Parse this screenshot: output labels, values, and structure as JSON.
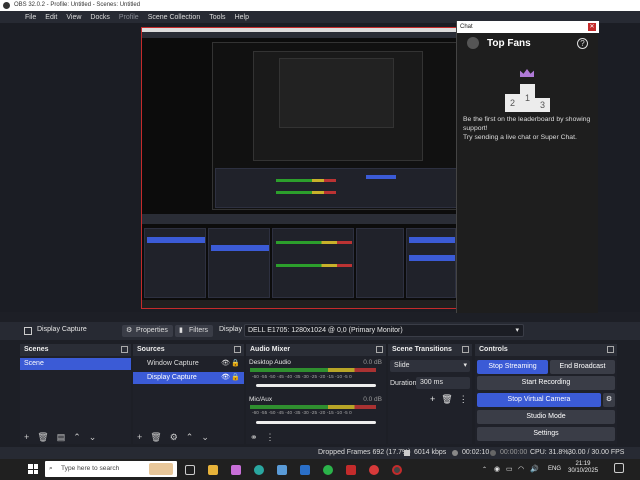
{
  "window": {
    "title": "OBS 32.0.2 - Profile: Untitled - Scenes: Untitled"
  },
  "menu": [
    "File",
    "Edit",
    "View",
    "Docks",
    "Profile",
    "Scene Collection",
    "Tools",
    "Help"
  ],
  "chat": {
    "header": "Chat",
    "title": "Top Fans",
    "message_line1": "Be the first on the leaderboard by showing support!",
    "message_line2": "Try sending a live chat or Super Chat.",
    "podium": [
      "2",
      "1",
      "3"
    ]
  },
  "toolbar": {
    "source_name": "Display Capture",
    "properties": "Properties",
    "filters": "Filters",
    "display_label": "Display",
    "display_value": "DELL E1705: 1280x1024 @ 0,0 (Primary Monitor)"
  },
  "scenes": {
    "title": "Scenes",
    "items": [
      "Scene"
    ]
  },
  "sources": {
    "title": "Sources",
    "items": [
      "Window Capture",
      "Display Capture"
    ]
  },
  "mixer": {
    "title": "Audio Mixer",
    "channels": [
      {
        "name": "Desktop Audio",
        "level": "0.0 dB",
        "scale": "-60 -55 -50 -45 -40 -35 -30 -25 -20 -15 -10 -5 0"
      },
      {
        "name": "Mic/Aux",
        "level": "0.0 dB",
        "scale": "-60 -55 -50 -45 -40 -35 -30 -25 -20 -15 -10 -5 0"
      }
    ]
  },
  "transitions": {
    "title": "Scene Transitions",
    "type": "Slide",
    "duration_label": "Duration",
    "duration_value": "300 ms"
  },
  "controls": {
    "title": "Controls",
    "stop_streaming": "Stop Streaming",
    "end_broadcast": "End Broadcast",
    "start_recording": "Start Recording",
    "stop_virtual_camera": "Stop Virtual Camera",
    "studio_mode": "Studio Mode",
    "settings": "Settings"
  },
  "status": {
    "dropped": "Dropped Frames 692 (17.7%)",
    "bitrate": "6014 kbps",
    "stream_time": "00:02:10",
    "rec_time": "00:00:00",
    "cpu": "CPU: 31.8%,",
    "fps": "30.00 / 30.00 FPS"
  },
  "taskbar": {
    "search_placeholder": "Type here to search",
    "lang": "ENG",
    "time": "21:19",
    "date": "30/10/2025"
  },
  "colors": {
    "accent": "#3b5bd6",
    "live_red": "#c42b2b"
  }
}
